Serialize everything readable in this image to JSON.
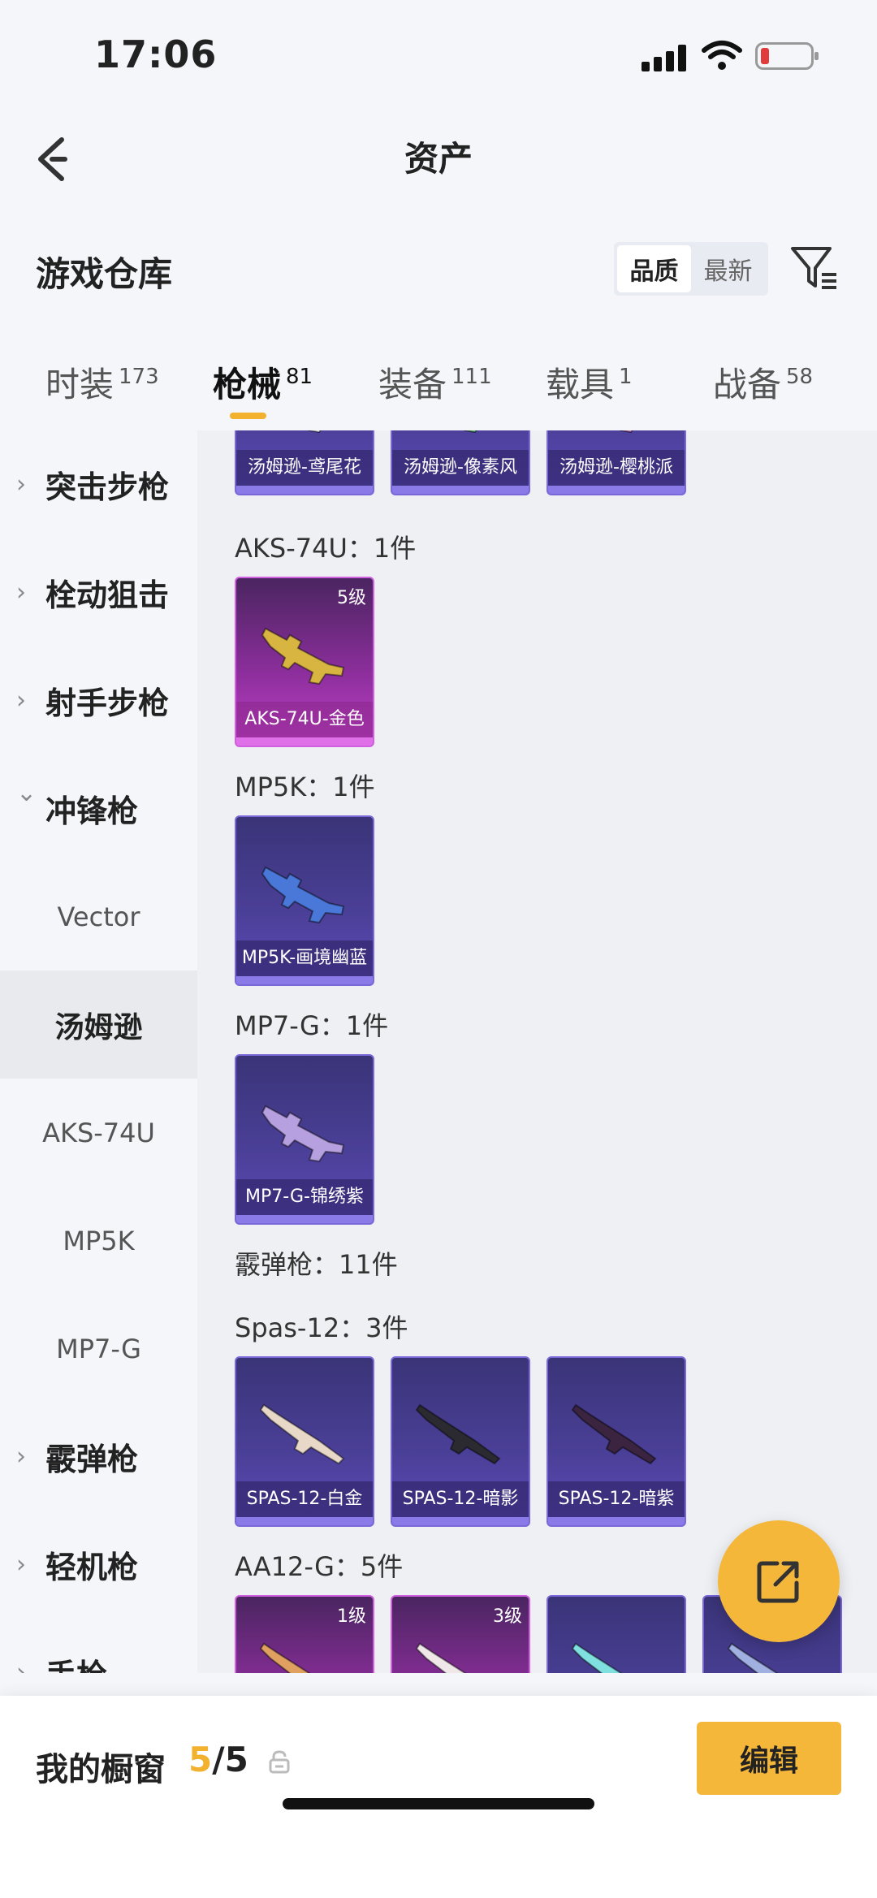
{
  "status": {
    "time": "17:06"
  },
  "header": {
    "title": "资产"
  },
  "section": {
    "title": "游戏仓库",
    "sort_options": [
      "品质",
      "最新"
    ],
    "sort_selected": "品质"
  },
  "tabs": [
    {
      "label": "时装",
      "count": "173"
    },
    {
      "label": "枪械",
      "count": "81"
    },
    {
      "label": "装备",
      "count": "111"
    },
    {
      "label": "载具",
      "count": "1"
    },
    {
      "label": "战备",
      "count": "58"
    }
  ],
  "sidebar": [
    {
      "label": "突击步枪",
      "type": "category",
      "expanded": false
    },
    {
      "label": "栓动狙击",
      "type": "category",
      "expanded": false
    },
    {
      "label": "射手步枪",
      "type": "category",
      "expanded": false
    },
    {
      "label": "冲锋枪",
      "type": "category",
      "expanded": true
    },
    {
      "label": "Vector",
      "type": "sub"
    },
    {
      "label": "汤姆逊",
      "type": "sub",
      "selected": true
    },
    {
      "label": "AKS-74U",
      "type": "sub"
    },
    {
      "label": "MP5K",
      "type": "sub"
    },
    {
      "label": "MP7-G",
      "type": "sub"
    },
    {
      "label": "霰弹枪",
      "type": "category",
      "expanded": false
    },
    {
      "label": "轻机枪",
      "type": "category",
      "expanded": false
    },
    {
      "label": "手枪",
      "type": "category",
      "expanded": false
    }
  ],
  "content": {
    "top_cards": [
      {
        "caption": "汤姆逊-鸢尾花",
        "color": "#ffffff"
      },
      {
        "caption": "汤姆逊-像素风",
        "color": "#5fd66a"
      },
      {
        "caption": "汤姆逊-樱桃派",
        "color": "#e48ad2"
      }
    ],
    "groups": [
      {
        "title": "AKS-74U：1件",
        "cards": [
          {
            "caption": "AKS-74U-金色",
            "level": "5级",
            "rarity": "pink",
            "color": "#d8b440"
          }
        ]
      },
      {
        "title": "MP5K：1件",
        "cards": [
          {
            "caption": "MP5K-画境幽蓝",
            "rarity": "purple",
            "color": "#4a78d8"
          }
        ]
      },
      {
        "title": "MP7-G：1件",
        "cards": [
          {
            "caption": "MP7-G-锦绣紫",
            "rarity": "purple",
            "color": "#b6a0e0"
          }
        ]
      },
      {
        "title": "霰弹枪：11件",
        "cards": []
      },
      {
        "title": "Spas-12：3件",
        "cards": [
          {
            "caption": "SPAS-12-白金",
            "rarity": "purple",
            "color": "#e8d8c8"
          },
          {
            "caption": "SPAS-12-暗影",
            "rarity": "purple",
            "color": "#2a2a30"
          },
          {
            "caption": "SPAS-12-暗紫",
            "rarity": "purple",
            "color": "#3a2440"
          }
        ]
      },
      {
        "title": "AA12-G：5件",
        "cards": [
          {
            "caption": "",
            "level": "1级",
            "rarity": "pink",
            "color": "#e0a060"
          },
          {
            "caption": "",
            "level": "3级",
            "rarity": "pink",
            "color": "#f0e8e8"
          },
          {
            "caption": "",
            "rarity": "purple",
            "color": "#80e0e0"
          },
          {
            "caption": "",
            "rarity": "purple",
            "color": "#a0b0e0"
          }
        ]
      }
    ]
  },
  "bottom": {
    "showcase_label": "我的橱窗",
    "showcase_current": "5",
    "showcase_total": "/5",
    "edit_label": "编辑"
  },
  "colors": {
    "accent": "#f5b73a",
    "underline": "#f2b12f"
  }
}
